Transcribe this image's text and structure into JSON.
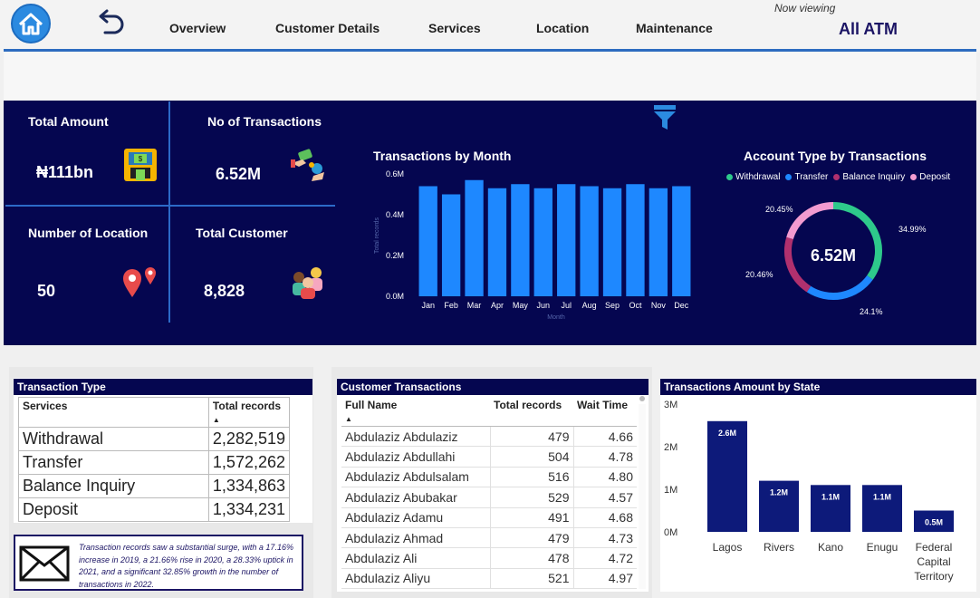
{
  "nav": {
    "items": [
      "Overview",
      "Customer Details",
      "Services",
      "Location",
      "Maintenance"
    ],
    "viewing_label": "Now viewing",
    "viewing_value": "All ATM",
    "home_icon": "home-icon",
    "back_icon": "back-arrow-icon"
  },
  "kpis": {
    "total_amount": {
      "title": "Total Amount",
      "value": "₦111bn",
      "icon": "atm-icon"
    },
    "no_transactions": {
      "title": "No of Transactions",
      "value": "6.52M",
      "icon": "money-exchange-icon"
    },
    "locations": {
      "title": "Number of Location",
      "value": "50",
      "icon": "location-pin-icon"
    },
    "customers": {
      "title": "Total Customer",
      "value": "8,828",
      "icon": "people-icon"
    }
  },
  "colors": {
    "dark_panel": "#050650",
    "bar_blue": "#1e88ff",
    "withdrawal": "#2ec98b",
    "transfer": "#1e88ff",
    "balance_inquiry": "#b0306e",
    "deposit": "#f29bd0",
    "state_bar": "#0d1a7a"
  },
  "monthly_chart": {
    "title": "Transactions by Month",
    "y_ticks": [
      "0.6M",
      "0.4M",
      "0.2M",
      "0.0M"
    ],
    "ylabel": "Total records",
    "xlabel": "Month"
  },
  "account_chart": {
    "title": "Account Type by Transactions",
    "center": "6.52M",
    "legend": [
      "Withdrawal",
      "Transfer",
      "Balance Inquiry",
      "Deposit"
    ],
    "labels": [
      "34.99%",
      "24.1%",
      "20.46%",
      "20.45%"
    ]
  },
  "chart_data": [
    {
      "type": "bar",
      "title": "Transactions by Month",
      "xlabel": "Month",
      "ylabel": "Total records",
      "categories": [
        "Jan",
        "Feb",
        "Mar",
        "Apr",
        "May",
        "Jun",
        "Jul",
        "Aug",
        "Sep",
        "Oct",
        "Nov",
        "Dec"
      ],
      "values": [
        0.54,
        0.5,
        0.57,
        0.53,
        0.55,
        0.53,
        0.55,
        0.54,
        0.53,
        0.55,
        0.53,
        0.54
      ],
      "units": "M",
      "ylim": [
        0,
        0.6
      ]
    },
    {
      "type": "pie",
      "title": "Account Type by Transactions",
      "categories": [
        "Withdrawal",
        "Transfer",
        "Balance Inquiry",
        "Deposit"
      ],
      "values": [
        34.99,
        24.1,
        20.46,
        20.45
      ]
    },
    {
      "type": "bar",
      "title": "Transactions Amount by State",
      "categories": [
        "Lagos",
        "Rivers",
        "Kano",
        "Enugu",
        "Federal Capital Territory"
      ],
      "values": [
        2.6,
        1.2,
        1.1,
        1.1,
        0.5
      ],
      "value_labels": [
        "2.6M",
        "1.2M",
        "1.1M",
        "1.1M",
        "0.5M"
      ],
      "units": "M",
      "y_ticks": [
        "3M",
        "2M",
        "1M",
        "0M"
      ],
      "ylim": [
        0,
        3
      ]
    }
  ],
  "transaction_type": {
    "title": "Transaction Type",
    "headers": [
      "Services",
      "Total records"
    ],
    "rows": [
      [
        "Withdrawal",
        "2,282,519"
      ],
      [
        "Transfer",
        "1,572,262"
      ],
      [
        "Balance Inquiry",
        "1,334,863"
      ],
      [
        "Deposit",
        "1,334,231"
      ]
    ]
  },
  "insight": {
    "text": "Transaction records saw a substantial surge, with a 17.16% increase in 2019, a 21.66% rise in 2020, a 28.33% uptick in 2021, and a significant 32.85% growth in the number of transactions in 2022.",
    "icon": "mail-icon"
  },
  "customer_transactions": {
    "title": "Customer Transactions",
    "headers": [
      "Full Name",
      "Total records",
      "Wait Time"
    ],
    "rows": [
      [
        "Abdulaziz Abdulaziz",
        "479",
        "4.66"
      ],
      [
        "Abdulaziz Abdullahi",
        "504",
        "4.78"
      ],
      [
        "Abdulaziz Abdulsalam",
        "516",
        "4.80"
      ],
      [
        "Abdulaziz Abubakar",
        "529",
        "4.57"
      ],
      [
        "Abdulaziz Adamu",
        "491",
        "4.68"
      ],
      [
        "Abdulaziz Ahmad",
        "479",
        "4.73"
      ],
      [
        "Abdulaziz Ali",
        "478",
        "4.72"
      ],
      [
        "Abdulaziz Aliyu",
        "521",
        "4.97"
      ]
    ]
  },
  "state_chart": {
    "title": "Transactions Amount by State"
  }
}
